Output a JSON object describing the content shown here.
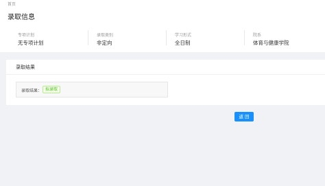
{
  "breadcrumb": "首页",
  "title": "录取信息",
  "info": [
    {
      "label": "专项计划",
      "value": "无专项计划"
    },
    {
      "label": "录取类别",
      "value": "非定向"
    },
    {
      "label": "学习形式",
      "value": "全日制"
    },
    {
      "label": "院系",
      "value": "体育与健康学院"
    }
  ],
  "result": {
    "card_title": "录取结果",
    "label": "录取结果：",
    "status": "拟录取",
    "status_color": "#52c41a"
  },
  "back_button": "返 回",
  "colors": {
    "primary": "#1890ff"
  }
}
